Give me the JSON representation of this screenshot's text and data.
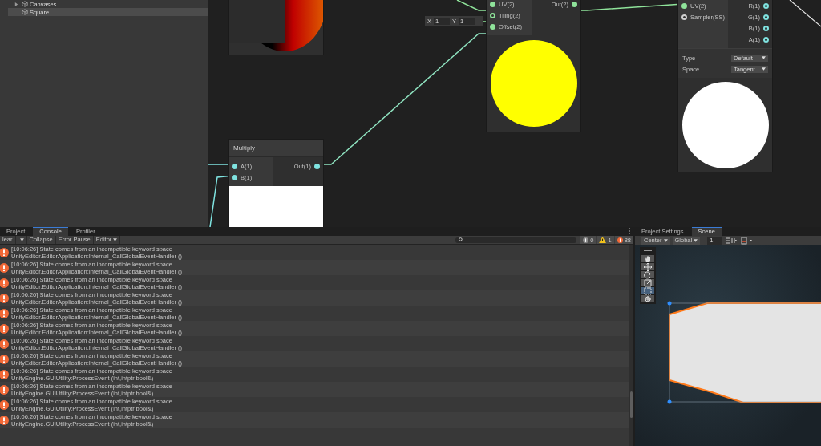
{
  "hierarchy": {
    "items": [
      {
        "label": "Canvases",
        "kind": "group",
        "selected": false
      },
      {
        "label": "Square",
        "kind": "object",
        "selected": true
      }
    ]
  },
  "graph": {
    "nodes": [
      {
        "preview": {
          "kind": "gradient-circle",
          "color": "#c00000"
        }
      },
      {
        "title": "Multiply",
        "inputs": [
          {
            "label": "A(1)",
            "connected": true,
            "color": "#7fe3e0"
          },
          {
            "label": "B(1)",
            "connected": true,
            "color": "#7fe3e0"
          }
        ],
        "outputs": [
          {
            "label": "Out(1)",
            "connected": true,
            "color": "#7fe3e0"
          }
        ],
        "preview": {
          "kind": "rect",
          "color": "#ffffff"
        }
      },
      {
        "inputs": [
          {
            "label": "UV(2)",
            "connected": true,
            "color": "#8fe39a"
          },
          {
            "label": "Tiling(2)",
            "connected": false,
            "color": "#8fe39a"
          },
          {
            "label": "Offset(2)",
            "connected": true,
            "color": "#8fe39a"
          }
        ],
        "outputs": [
          {
            "label": "Out(2)",
            "connected": true,
            "color": "#8fe39a"
          }
        ],
        "preview": {
          "kind": "circle",
          "color": "#ffff00"
        }
      },
      {
        "inputs": [
          {
            "label": "UV(2)",
            "connected": true,
            "color": "#8fe39a"
          },
          {
            "label": "Sampler(SS)",
            "connected": false,
            "color": "#cfcfcf"
          }
        ],
        "outputs": [
          {
            "label": "R(1)",
            "connected": false,
            "color": "#7fe3e0"
          },
          {
            "label": "G(1)",
            "connected": false,
            "color": "#7fe3e0"
          },
          {
            "label": "B(1)",
            "connected": false,
            "color": "#7fe3e0"
          },
          {
            "label": "A(1)",
            "connected": false,
            "color": "#7fe3e0"
          }
        ],
        "dropdowns": [
          {
            "label": "Type",
            "value": "Default"
          },
          {
            "label": "Space",
            "value": "Tangent"
          }
        ],
        "preview": {
          "kind": "circle",
          "color": "#ffffff"
        }
      }
    ],
    "tiling_field": {
      "x_label": "X",
      "x_value": "1",
      "y_label": "Y",
      "y_value": "1"
    }
  },
  "console": {
    "tabs": [
      {
        "label": "Project",
        "selected": false
      },
      {
        "label": "Console",
        "selected": true
      },
      {
        "label": "Profiler",
        "selected": false
      }
    ],
    "toolbar": [
      {
        "label": "lear",
        "kind": "button"
      },
      {
        "kind": "caret"
      },
      {
        "label": "Collapse",
        "kind": "button"
      },
      {
        "label": "Error Pause",
        "kind": "button"
      },
      {
        "label": "Editor",
        "kind": "dropdown"
      }
    ],
    "counts": [
      {
        "kind": "info",
        "count": "0"
      },
      {
        "kind": "warning",
        "count": "1"
      },
      {
        "kind": "error",
        "count": "88"
      }
    ],
    "rows": [
      {
        "kind": "error",
        "message": "[10:06:26] State comes from an incompatible keyword space",
        "trace": "UnityEditor.EditorApplication:Internal_CallGlobalEventHandler ()"
      },
      {
        "kind": "error",
        "message": "[10:06:26] State comes from an incompatible keyword space",
        "trace": "UnityEditor.EditorApplication:Internal_CallGlobalEventHandler ()"
      },
      {
        "kind": "error",
        "message": "[10:06:26] State comes from an incompatible keyword space",
        "trace": "UnityEditor.EditorApplication:Internal_CallGlobalEventHandler ()"
      },
      {
        "kind": "error",
        "message": "[10:06:26] State comes from an incompatible keyword space",
        "trace": "UnityEditor.EditorApplication:Internal_CallGlobalEventHandler ()"
      },
      {
        "kind": "error",
        "message": "[10:06:26] State comes from an incompatible keyword space",
        "trace": "UnityEditor.EditorApplication:Internal_CallGlobalEventHandler ()"
      },
      {
        "kind": "error",
        "message": "[10:06:26] State comes from an incompatible keyword space",
        "trace": "UnityEditor.EditorApplication:Internal_CallGlobalEventHandler ()"
      },
      {
        "kind": "error",
        "message": "[10:06:26] State comes from an incompatible keyword space",
        "trace": "UnityEditor.EditorApplication:Internal_CallGlobalEventHandler ()"
      },
      {
        "kind": "error",
        "message": "[10:06:26] State comes from an incompatible keyword space",
        "trace": "UnityEditor.EditorApplication:Internal_CallGlobalEventHandler ()"
      },
      {
        "kind": "error",
        "message": "[10:06:26] State comes from an incompatible keyword space",
        "trace": "UnityEngine.GUIUtility:ProcessEvent (int,intptr,bool&)"
      },
      {
        "kind": "error",
        "message": "[10:06:26] State comes from an incompatible keyword space",
        "trace": "UnityEngine.GUIUtility:ProcessEvent (int,intptr,bool&)"
      },
      {
        "kind": "error",
        "message": "[10:06:26] State comes from an incompatible keyword space",
        "trace": "UnityEngine.GUIUtility:ProcessEvent (int,intptr,bool&)"
      },
      {
        "kind": "error",
        "message": "[10:06:26] State comes from an incompatible keyword space",
        "trace": "UnityEngine.GUIUtility:ProcessEvent (int,intptr,bool&)"
      }
    ]
  },
  "scene": {
    "tabs": [
      {
        "label": "Project Settings",
        "selected": false
      },
      {
        "label": "Scene",
        "selected": true
      }
    ],
    "toolbar": {
      "pivot": "Center",
      "space": "Global",
      "grid_value": "1"
    },
    "tools": [
      {
        "kind": "hand",
        "selected": false
      },
      {
        "kind": "move",
        "selected": false
      },
      {
        "kind": "rotate",
        "selected": false
      },
      {
        "kind": "scale",
        "selected": false
      },
      {
        "kind": "rect",
        "selected": true
      },
      {
        "kind": "transform",
        "selected": false
      }
    ]
  }
}
